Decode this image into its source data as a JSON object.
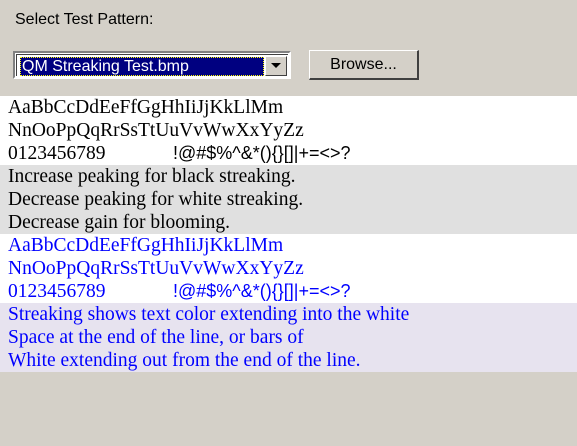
{
  "select_label": "Select Test Pattern:",
  "combo": {
    "value": "QM Streaking Test.bmp"
  },
  "browse_label": "Browse...",
  "black_text": {
    "line1": "AaBbCcDdEeFfGgHhIiJjKkLlMm",
    "line2": "NnOoPpQqRrSsTtUuVvWwXxYyZz",
    "digits": "0123456789",
    "symbols": "!@#$%^&*(){}[]|+=<>?"
  },
  "instructions": [
    "Increase peaking for black streaking.",
    "Decrease peaking for white streaking.",
    "Decrease gain for blooming."
  ],
  "blue_text": {
    "line1": "AaBbCcDdEeFfGgHhIiJjKkLlMm",
    "line2": "NnOoPpQqRrSsTtUuVvWwXxYyZz",
    "digits": "0123456789",
    "symbols": "!@#$%^&*(){}[]|+=<>?"
  },
  "explanation": [
    "Streaking shows text color extending into the white",
    "Space at the end of the line, or bars of",
    "White extending out from the end of the line."
  ],
  "colors": {
    "background": "#d4d0c8",
    "selection": "#000080",
    "blue_text": "#0000ff"
  }
}
